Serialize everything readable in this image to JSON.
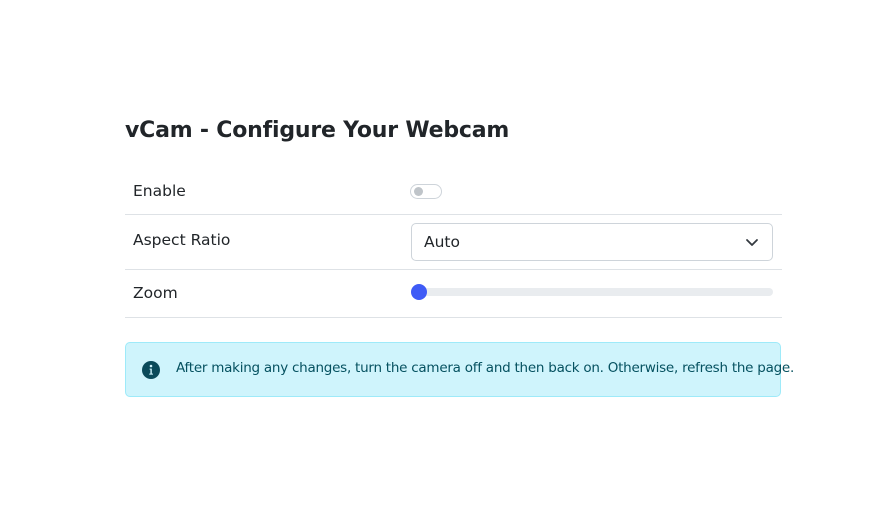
{
  "page": {
    "title": "vCam - Configure Your Webcam"
  },
  "settings": {
    "enable": {
      "label": "Enable",
      "checked": false
    },
    "aspect_ratio": {
      "label": "Aspect Ratio",
      "selected": "Auto"
    },
    "zoom": {
      "label": "Zoom",
      "value_fraction": 0
    }
  },
  "alert": {
    "icon": "info-icon",
    "text": "After making any changes, turn the camera off and then back on. Otherwise, refresh the page."
  },
  "colors": {
    "accent": "#3f5bf6",
    "alert_bg": "#cff4fc",
    "alert_border": "#9eeaf9",
    "alert_text": "#055160",
    "divider": "#dee2e6"
  }
}
